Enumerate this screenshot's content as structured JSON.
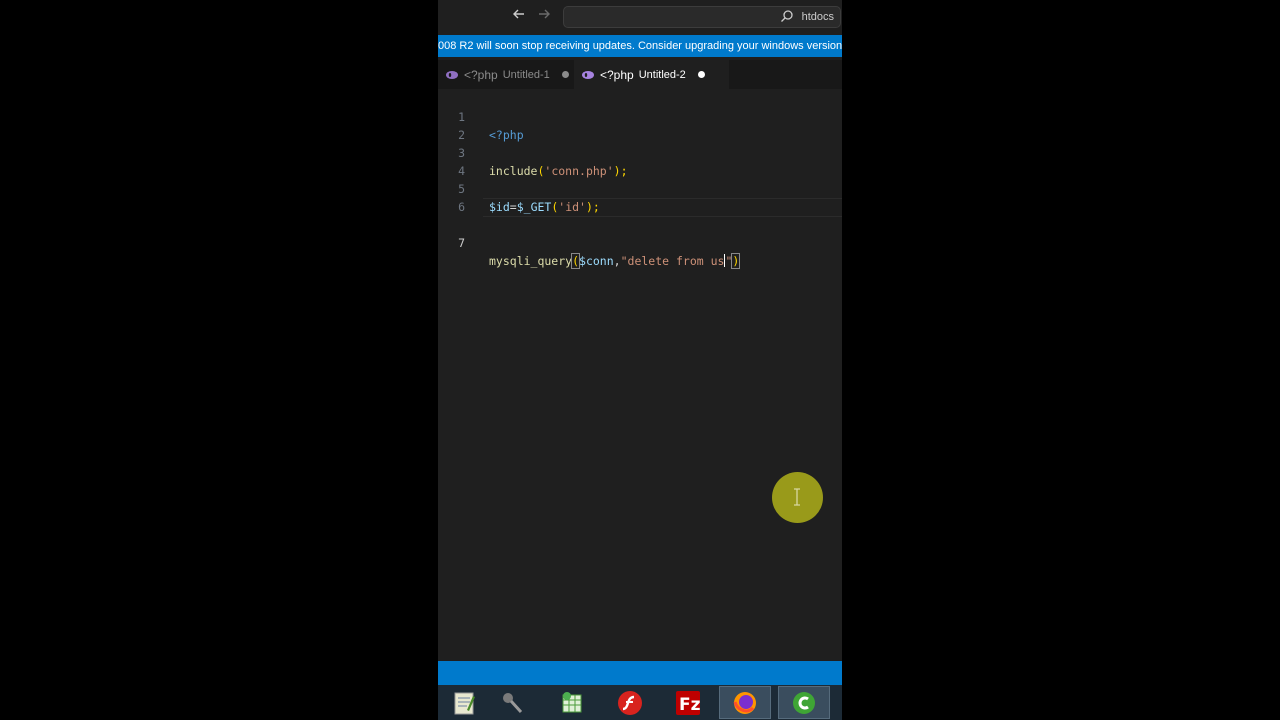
{
  "titlebar": {
    "back_icon": "arrow-left-icon",
    "forward_icon": "arrow-right-icon",
    "search_text": "htdocs"
  },
  "notice": {
    "text": "008 R2 will soon stop receiving updates. Consider upgrading your windows version"
  },
  "tabs": [
    {
      "lang": "<?php",
      "label": "Untitled-1",
      "active": false,
      "dirty": true
    },
    {
      "lang": "<?php",
      "label": "Untitled-2",
      "active": true,
      "dirty": true
    }
  ],
  "editor": {
    "line_numbers": [
      "1",
      "2",
      "3",
      "4",
      "5",
      "6",
      "7"
    ],
    "lines": {
      "l1": "<?php",
      "l3_fn": "include",
      "l3_open": "(",
      "l3_str": "'conn.php'",
      "l3_close": ");",
      "l5_var": "$id",
      "l5_eq": "=",
      "l5_get": "$_GET",
      "l5_open": "(",
      "l5_str": "'id'",
      "l5_close": ");",
      "l7_fn": "mysqli_query",
      "l7_open": "(",
      "l7_var": "$conn",
      "l7_comma": ",",
      "l7_str": "\"delete from us",
      "l7_quote": "\"",
      "l7_close": ")"
    },
    "current_line": "7"
  },
  "taskbar": {
    "icons": [
      "notepad-icon",
      "microphone-icon",
      "spreadsheet-icon",
      "flash-icon",
      "filezilla-icon",
      "firefox-icon",
      "camtasia-icon"
    ]
  },
  "colors": {
    "accent": "#007acc",
    "editor_bg": "#1f1f1f",
    "highlight": "#a6a71a"
  }
}
